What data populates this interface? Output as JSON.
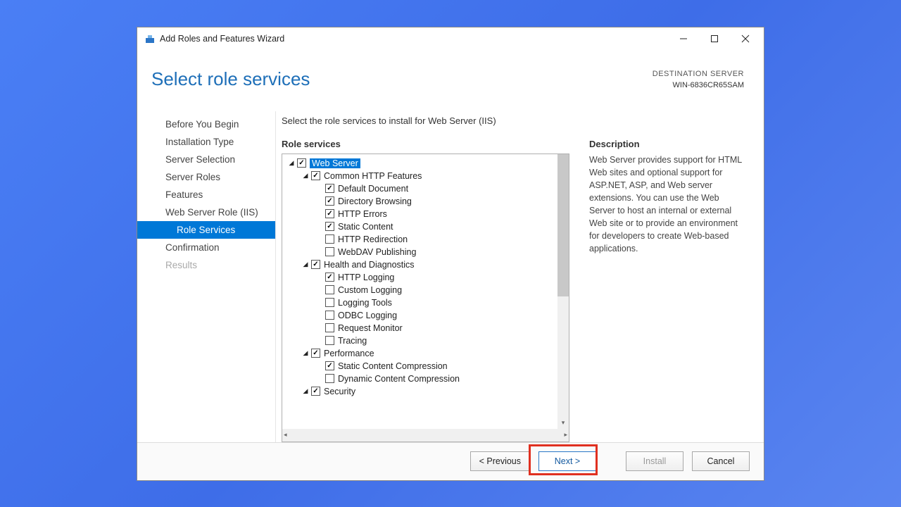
{
  "window": {
    "title": "Add Roles and Features Wizard"
  },
  "header": {
    "page_title": "Select role services",
    "dest_label": "DESTINATION SERVER",
    "dest_name": "WIN-6836CR65SAM"
  },
  "sidebar": {
    "items": [
      {
        "label": "Before You Begin",
        "sub": false,
        "active": false,
        "disabled": false
      },
      {
        "label": "Installation Type",
        "sub": false,
        "active": false,
        "disabled": false
      },
      {
        "label": "Server Selection",
        "sub": false,
        "active": false,
        "disabled": false
      },
      {
        "label": "Server Roles",
        "sub": false,
        "active": false,
        "disabled": false
      },
      {
        "label": "Features",
        "sub": false,
        "active": false,
        "disabled": false
      },
      {
        "label": "Web Server Role (IIS)",
        "sub": false,
        "active": false,
        "disabled": false
      },
      {
        "label": "Role Services",
        "sub": true,
        "active": true,
        "disabled": false
      },
      {
        "label": "Confirmation",
        "sub": false,
        "active": false,
        "disabled": false
      },
      {
        "label": "Results",
        "sub": false,
        "active": false,
        "disabled": true
      }
    ]
  },
  "main": {
    "instruction": "Select the role services to install for Web Server (IIS)",
    "tree_title": "Role services",
    "desc_title": "Description",
    "desc_text": "Web Server provides support for HTML Web sites and optional support for ASP.NET, ASP, and Web server extensions. You can use the Web Server to host an internal or external Web site or to provide an environment for developers to create Web-based applications."
  },
  "tree": [
    {
      "label": "Web Server",
      "indent": 0,
      "exp": "open",
      "chk": true,
      "selected": true
    },
    {
      "label": "Common HTTP Features",
      "indent": 1,
      "exp": "open",
      "chk": true
    },
    {
      "label": "Default Document",
      "indent": 2,
      "exp": "none",
      "chk": true
    },
    {
      "label": "Directory Browsing",
      "indent": 2,
      "exp": "none",
      "chk": true
    },
    {
      "label": "HTTP Errors",
      "indent": 2,
      "exp": "none",
      "chk": true
    },
    {
      "label": "Static Content",
      "indent": 2,
      "exp": "none",
      "chk": true
    },
    {
      "label": "HTTP Redirection",
      "indent": 2,
      "exp": "none",
      "chk": false
    },
    {
      "label": "WebDAV Publishing",
      "indent": 2,
      "exp": "none",
      "chk": false
    },
    {
      "label": "Health and Diagnostics",
      "indent": 1,
      "exp": "open",
      "chk": true
    },
    {
      "label": "HTTP Logging",
      "indent": 2,
      "exp": "none",
      "chk": true
    },
    {
      "label": "Custom Logging",
      "indent": 2,
      "exp": "none",
      "chk": false
    },
    {
      "label": "Logging Tools",
      "indent": 2,
      "exp": "none",
      "chk": false
    },
    {
      "label": "ODBC Logging",
      "indent": 2,
      "exp": "none",
      "chk": false
    },
    {
      "label": "Request Monitor",
      "indent": 2,
      "exp": "none",
      "chk": false
    },
    {
      "label": "Tracing",
      "indent": 2,
      "exp": "none",
      "chk": false
    },
    {
      "label": "Performance",
      "indent": 1,
      "exp": "open",
      "chk": true
    },
    {
      "label": "Static Content Compression",
      "indent": 2,
      "exp": "none",
      "chk": true
    },
    {
      "label": "Dynamic Content Compression",
      "indent": 2,
      "exp": "none",
      "chk": false
    },
    {
      "label": "Security",
      "indent": 1,
      "exp": "open",
      "chk": true
    }
  ],
  "footer": {
    "previous": "< Previous",
    "next": "Next >",
    "install": "Install",
    "cancel": "Cancel"
  }
}
